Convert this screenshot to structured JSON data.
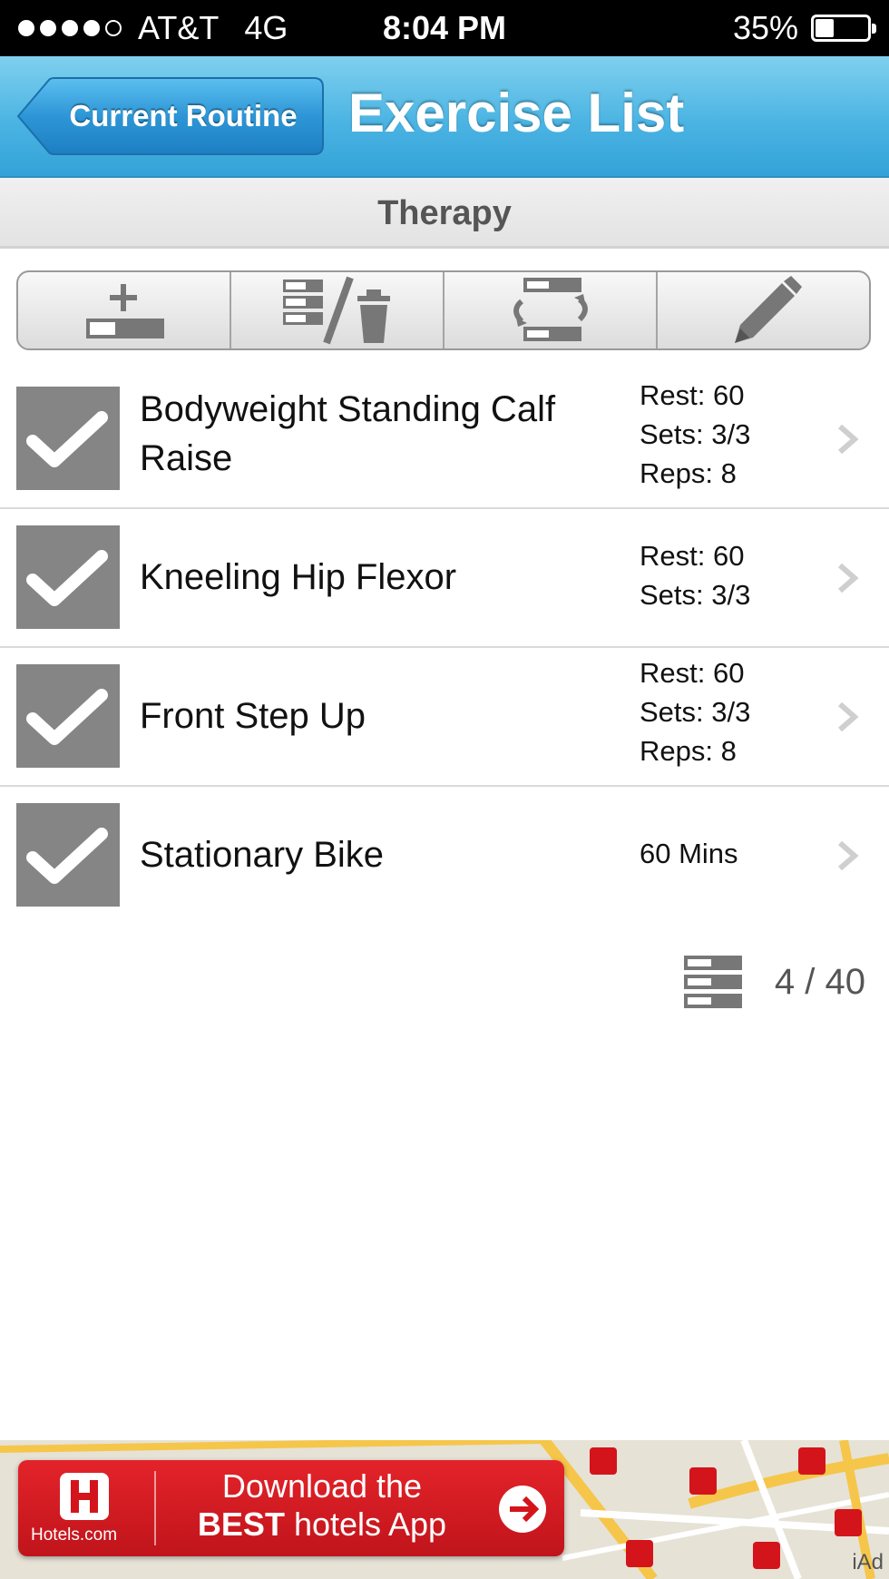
{
  "status_bar": {
    "carrier": "AT&T",
    "network": "4G",
    "time": "8:04 PM",
    "battery": "35%",
    "battery_level": 0.35
  },
  "nav": {
    "back_label": "Current Routine",
    "title": "Exercise List"
  },
  "section": {
    "title": "Therapy"
  },
  "toolbar": {
    "tools": [
      "add-exercise-icon",
      "reorder-delete-icon",
      "swap-icon",
      "pencil-icon"
    ]
  },
  "exercises": [
    {
      "name": "Bodyweight Standing Calf Raise",
      "stats": [
        "Rest: 60",
        "Sets: 3/3",
        "Reps: 8"
      ],
      "checked": true
    },
    {
      "name": "Kneeling Hip Flexor",
      "stats": [
        "Rest: 60",
        "Sets: 3/3"
      ],
      "checked": true
    },
    {
      "name": "Front Step Up",
      "stats": [
        "Rest: 60",
        "Sets: 3/3",
        "Reps: 8"
      ],
      "checked": true
    },
    {
      "name": "Stationary Bike",
      "stats": [
        "60 Mins"
      ],
      "checked": true
    }
  ],
  "count": {
    "text": "4 / 40"
  },
  "ad": {
    "brand": "Hotels.com",
    "line1": "Download the",
    "line2_bold": "BEST",
    "line2_rest": " hotels App",
    "network_label": "iAd"
  },
  "colors": {
    "nav_blue": "#4bb4e3",
    "check_gray": "#858585",
    "ad_red": "#d41c23"
  }
}
